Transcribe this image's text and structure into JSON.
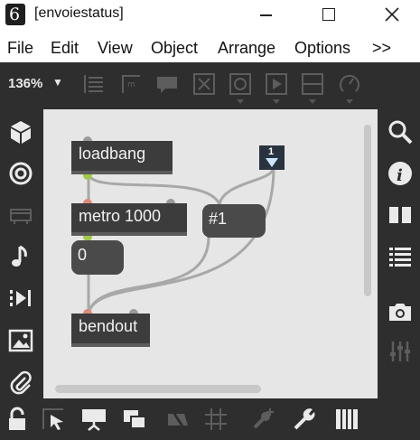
{
  "window": {
    "title": "[envoiestatus]",
    "app_icon_glyph": "6",
    "controls": [
      "minimize-icon",
      "maximize-icon",
      "close-icon"
    ]
  },
  "menu": {
    "items": [
      "File",
      "Edit",
      "View",
      "Object",
      "Arrange",
      "Options",
      ">>"
    ]
  },
  "toolbar": {
    "zoom": "136%",
    "zoom_arrow": "▼",
    "icons": [
      "list-icon",
      "comment-icon",
      "speech-bubble-icon",
      "x-box-icon",
      "button-icon",
      "playbar-icon",
      "slider-icon",
      "dial-icon"
    ]
  },
  "left_toolbar": {
    "icons": [
      "cube-icon",
      "target-icon",
      "presentation-icon",
      "music-note-icon",
      "step-forward-icon",
      "image-icon",
      "paperclip-icon"
    ]
  },
  "right_toolbar": {
    "icons": [
      "search-icon",
      "info-icon",
      "book-icon",
      "list-icon",
      "camera-icon",
      "mixer-icon"
    ]
  },
  "patch": {
    "objects": [
      {
        "id": "loadbang",
        "text": "loadbang"
      },
      {
        "id": "metro",
        "text": "metro 1000"
      },
      {
        "id": "msg_zero",
        "text": "0"
      },
      {
        "id": "msg_hash1",
        "text": "#1"
      },
      {
        "id": "bendout",
        "text": "bendout"
      },
      {
        "id": "inlet_1",
        "text": "1"
      }
    ]
  },
  "bottom_toolbar": {
    "icons": [
      "lock-icon",
      "select-icon",
      "presentation-icon",
      "windows-icon",
      "hide-icon",
      "grid-icon",
      "add-icon",
      "wrench-icon",
      "piano-icon"
    ]
  },
  "colors": {
    "chrome": "#2e2e2e",
    "canvas": "#e6e6e6",
    "object": "#3c3c3c",
    "patchcord": "#a8a8a8",
    "outlet": "#a0c84a",
    "inlet_box": "#2a3440"
  }
}
